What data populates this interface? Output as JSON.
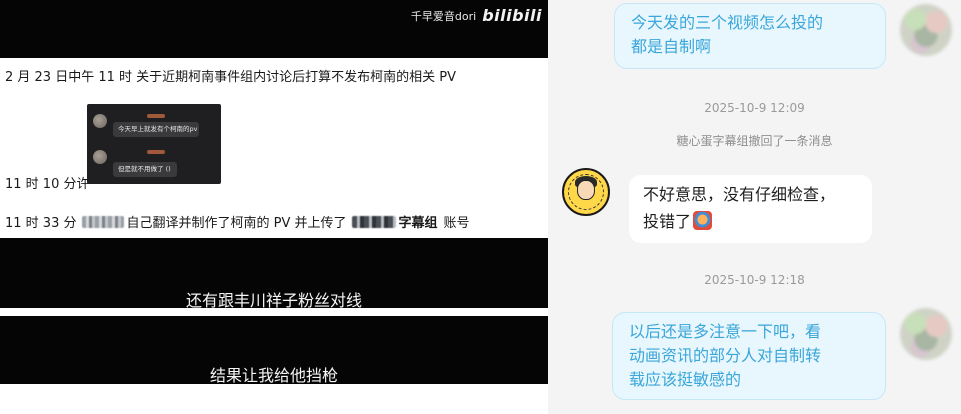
{
  "left_panel": {
    "watermark": {
      "text": "千早爱音dori",
      "logo": "bilibili"
    },
    "lines": {
      "line1": "2 月 23 日中午 11 时  关于近期柯南事件组内讨论后打算不发布柯南的相关 PV",
      "line2": "11 时 10 分许",
      "line3_pre": "11 时 33 分",
      "line3_mid": "自己翻译并制作了柯南的 PV 并上传了",
      "line3_bold": "字幕组",
      "line3_post": "账号"
    },
    "chat_thumbnail": {
      "bubble1": "今天早上就发有个柯南的pv",
      "bubble2": "但是就不用做了 ()"
    },
    "subtitles": {
      "sub1": "还有跟丰川祥子粉丝对线",
      "sub2": "结果让我给他挡枪"
    }
  },
  "right_panel": {
    "messages": [
      {
        "sender": "self",
        "text_line1": "今天发的三个视频怎么投的",
        "text_line2": "都是自制啊"
      },
      {
        "sender": "other",
        "text_line1": "不好意思，没有仔细检查，",
        "text_line2": "投错了",
        "emoji": "crying-face-emoji"
      },
      {
        "sender": "self",
        "text_line1": "以后还是多注意一下吧，看",
        "text_line2": "动画资讯的部分人对自制转",
        "text_line3": "载应该挺敏感的"
      }
    ],
    "timestamps": {
      "ts1": "2025-10-9 12:09",
      "ts2": "2025-10-9 12:18"
    },
    "recall_notice": "糖心蛋字幕组撤回了一条消息",
    "colors": {
      "self_bubble_bg": "#e8f7fd",
      "self_bubble_text": "#3aa6da",
      "other_bubble_bg": "#ffffff",
      "panel_bg": "#f4f4f5"
    }
  }
}
